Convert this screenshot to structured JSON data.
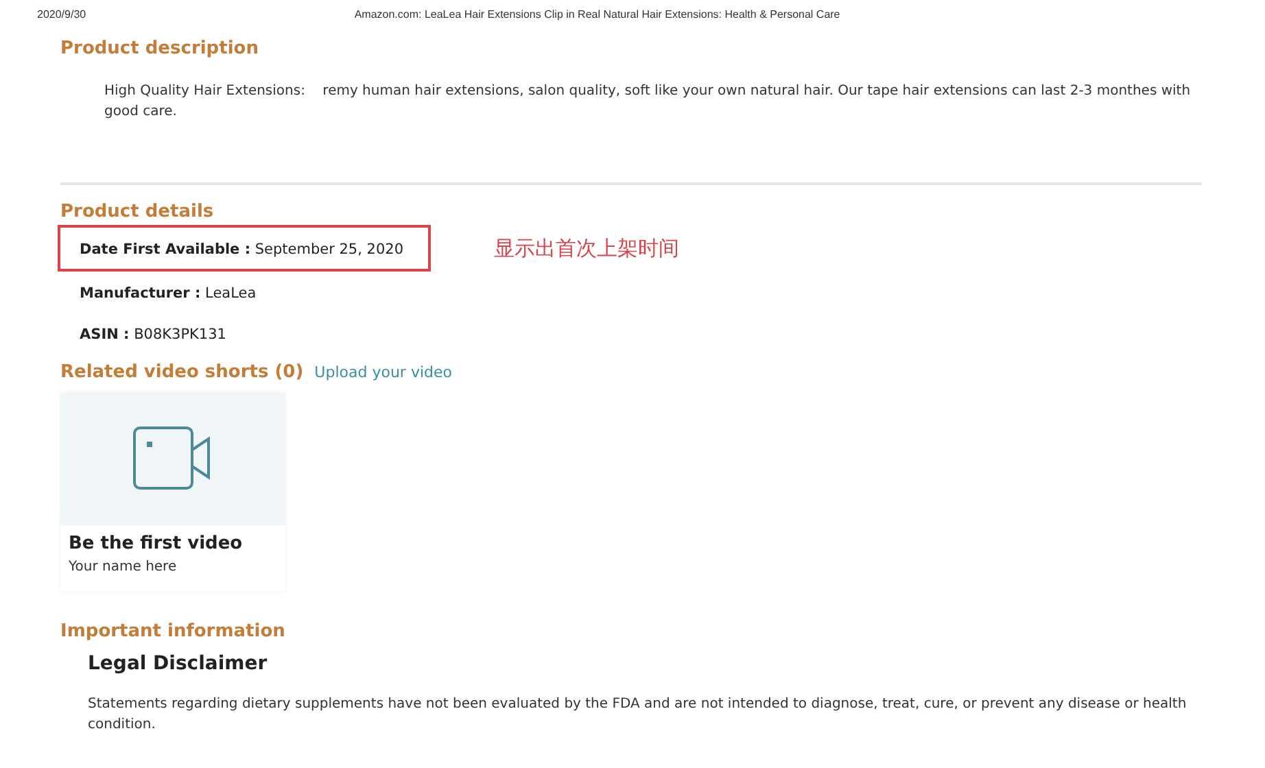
{
  "print_header": {
    "date": "2020/9/30",
    "title": "Amazon.com: LeaLea Hair Extensions Clip in Real Natural Hair Extensions: Health & Personal Care"
  },
  "product_description": {
    "heading": "Product description",
    "text": "High Quality Hair Extensions:    remy human hair extensions, salon quality, soft like your own natural hair. Our tape hair extensions can last 2-3 monthes with good care."
  },
  "product_details": {
    "heading": "Product details",
    "annotation": "显示出首次上架时间",
    "rows": [
      {
        "label": "Date First Available :",
        "value": "September 25, 2020",
        "highlighted": true
      },
      {
        "label": "Manufacturer :",
        "value": "LeaLea",
        "highlighted": false
      },
      {
        "label": "ASIN :",
        "value": "B08K3PK131",
        "highlighted": false
      }
    ]
  },
  "related_video_shorts": {
    "heading": "Related video shorts (0)",
    "link": "Upload your video",
    "card": {
      "title": "Be the first video",
      "subtitle": "Your name here"
    }
  },
  "important_information": {
    "heading": "Important information",
    "subheading": "Legal Disclaimer",
    "text": "Statements regarding dietary supplements have not been evaluated by the FDA and are not intended to diagnose, treat, cure, or prevent any disease or health condition."
  }
}
